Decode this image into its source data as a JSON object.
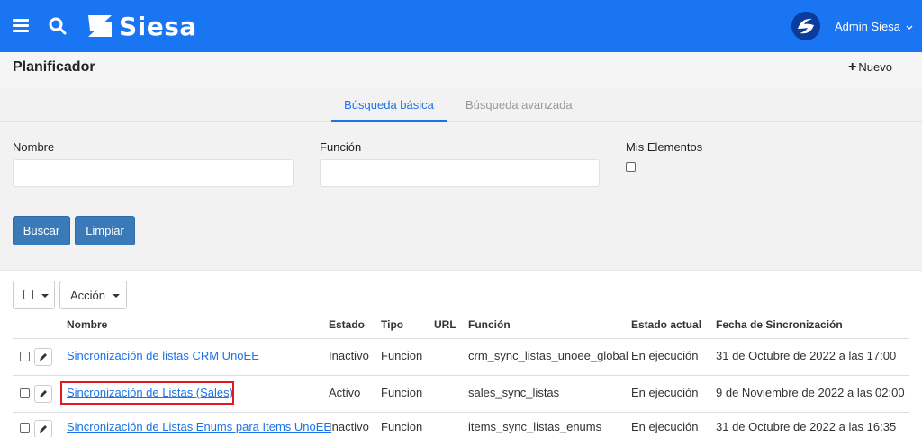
{
  "topbar": {
    "brand": "Siesa",
    "user_name": "Admin Siesa",
    "icons": [
      "menu-icon",
      "search-icon",
      "siesa-logo-icon",
      "user-avatar-icon",
      "chevron-down-icon"
    ],
    "bg_color": "#1a75f2"
  },
  "page": {
    "title": "Planificador",
    "new_label": "Nuevo"
  },
  "tabs": [
    {
      "label": "Búsqueda básica",
      "active": true
    },
    {
      "label": "Búsqueda avanzada",
      "active": false
    }
  ],
  "filters": {
    "nombre_label": "Nombre",
    "nombre_value": "",
    "funcion_label": "Función",
    "funcion_value": "",
    "mis_elementos_label": "Mis Elementos"
  },
  "buttons": {
    "search": "Buscar",
    "clear": "Limpiar"
  },
  "toolbar": {
    "action_label": "Acción"
  },
  "table": {
    "headers": {
      "nombre": "Nombre",
      "estado": "Estado",
      "tipo": "Tipo",
      "url": "URL",
      "funcion": "Función",
      "estado_actual": "Estado actual",
      "fecha": "Fecha de Sincronización"
    },
    "rows": [
      {
        "nombre": "Sincronización de listas CRM UnoEE",
        "estado": "Inactivo",
        "tipo": "Funcion",
        "url": "",
        "funcion": "crm_sync_listas_unoee_global",
        "estado_actual": "En ejecución",
        "fecha": "31 de Octubre de 2022 a las 17:00"
      },
      {
        "nombre": "Sincronización de Listas (Sales)",
        "estado": "Activo",
        "tipo": "Funcion",
        "url": "",
        "funcion": "sales_sync_listas",
        "estado_actual": "En ejecución",
        "fecha": "9 de Noviembre de 2022 a las 02:00"
      },
      {
        "nombre": "Sincronización de Listas Enums para Items UnoEE",
        "estado": "Inactivo",
        "tipo": "Funcion",
        "url": "",
        "funcion": "items_sync_listas_enums",
        "estado_actual": "En ejecución",
        "fecha": "31 de Octubre de 2022 a las 16:35"
      }
    ]
  },
  "colors": {
    "link": "#1a73e8",
    "button": "#3a7ab9",
    "highlight": "#e0191f"
  }
}
